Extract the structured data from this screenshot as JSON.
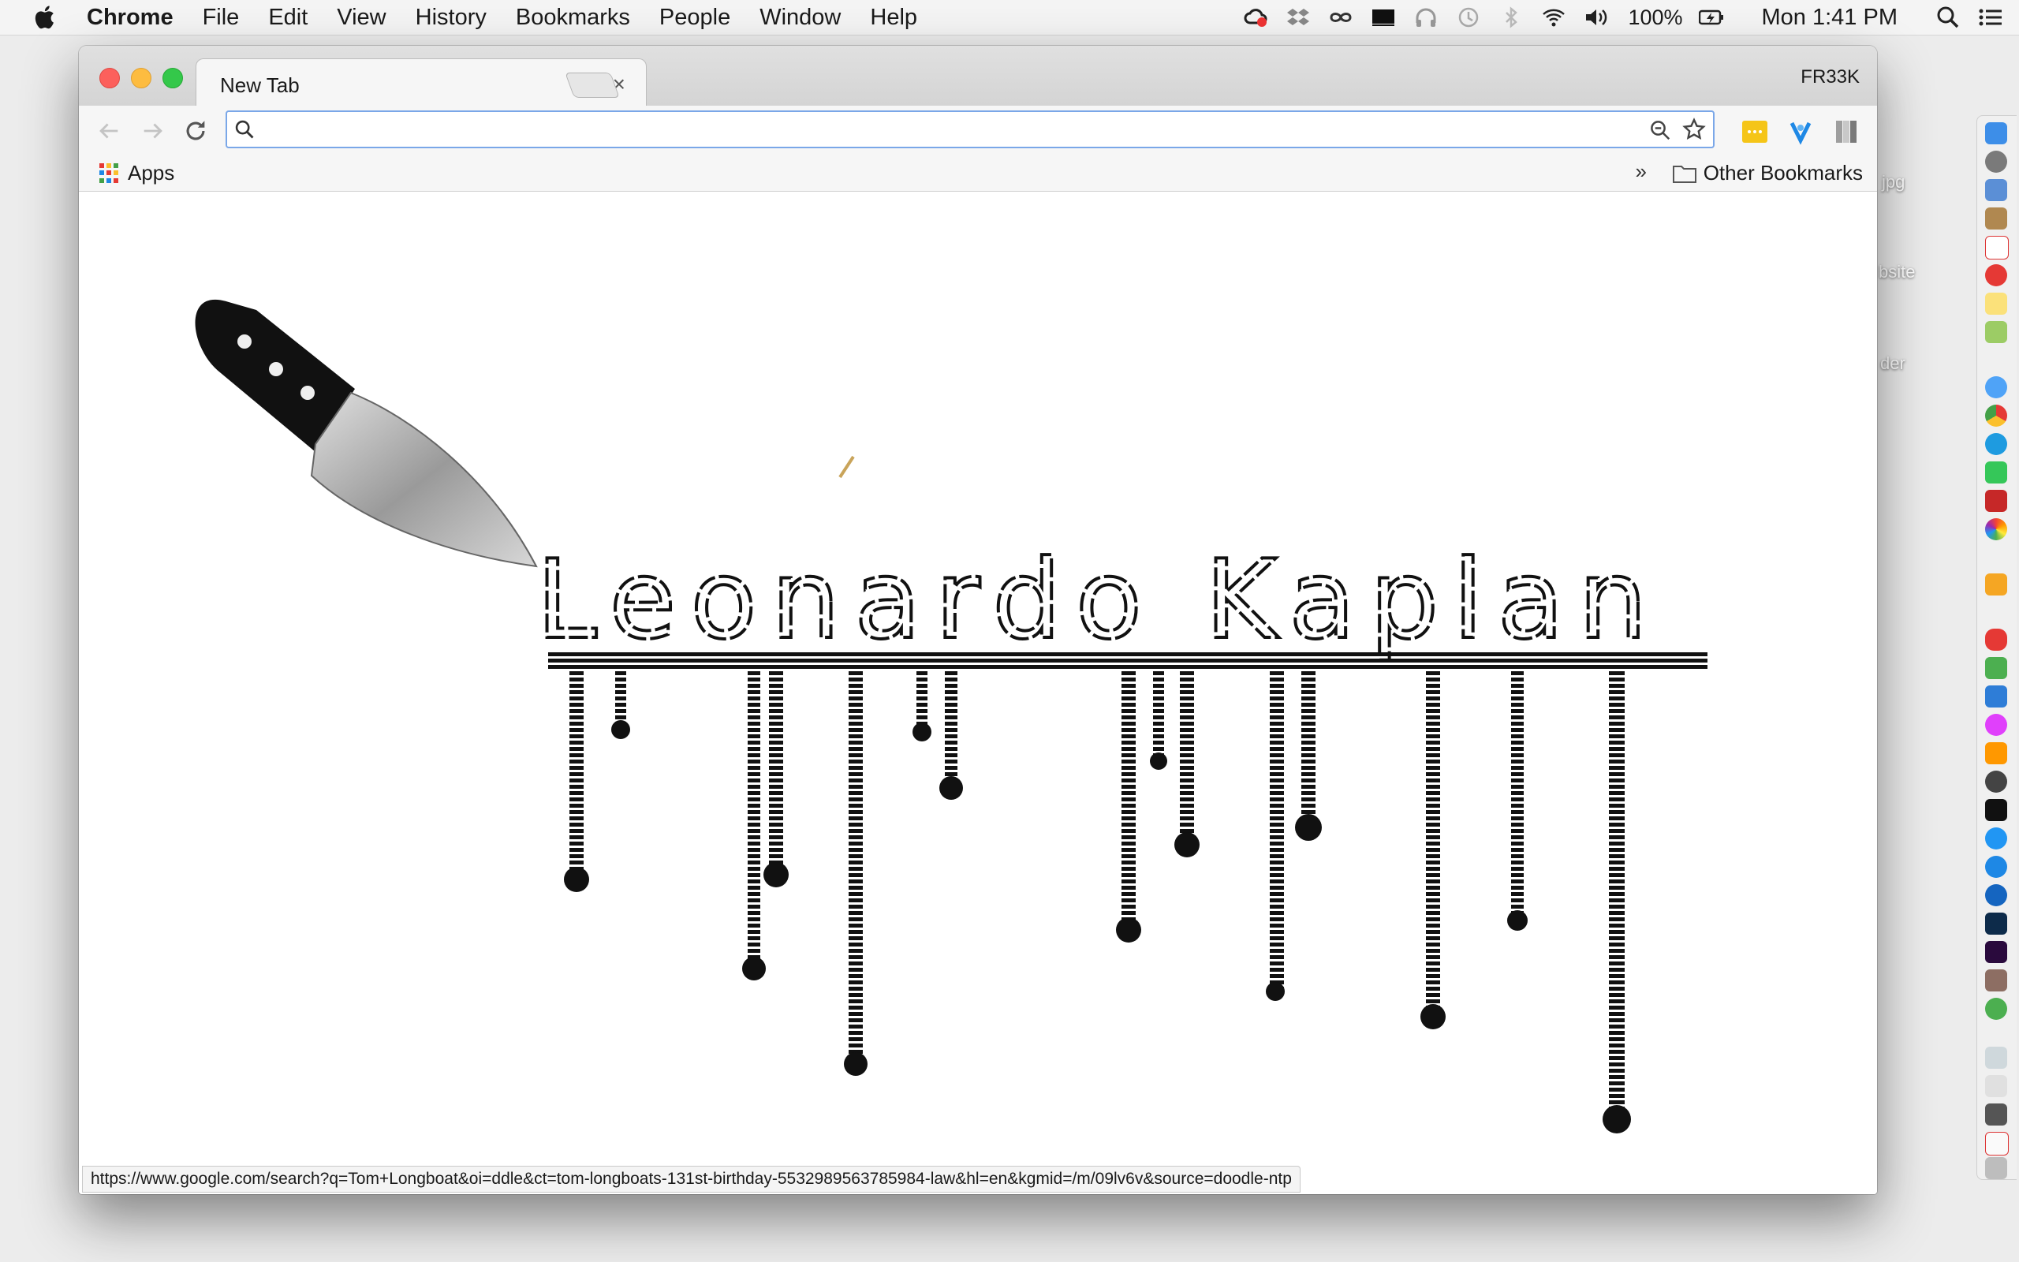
{
  "menubar": {
    "app_name": "Chrome",
    "menus": [
      "File",
      "Edit",
      "View",
      "History",
      "Bookmarks",
      "People",
      "Window",
      "Help"
    ],
    "battery_percent": "100%",
    "clock": "Mon 1:41 PM"
  },
  "desktop": {
    "labels": [
      "jpg",
      "bsite",
      "der"
    ]
  },
  "browser": {
    "tab_title": "New Tab",
    "tab_close": "×",
    "profile_name": "FR33K",
    "omnibox": {
      "value": "",
      "placeholder": ""
    },
    "bookmarks": {
      "apps_label": "Apps",
      "overflow_label": "»",
      "other_label": "Other Bookmarks"
    },
    "doodle": {
      "text": "Leonardo Kaplan"
    },
    "status_url": "https://www.google.com/search?q=Tom+Longboat&oi=ddle&ct=tom-longboats-131st-birthday-5532989563785984-law&hl=en&kgmid=/m/09lv6v&source=doodle-ntp"
  },
  "colors": {
    "omnibox_focus": "#7aa7e8",
    "traffic_close": "#fc605c",
    "traffic_min": "#fdbc40",
    "traffic_max": "#34c84a"
  },
  "icons": {
    "menubar_status": [
      "creative-cloud-icon",
      "dropbox-icon",
      "infinity-icon",
      "display-icon",
      "headphones-icon",
      "time-machine-icon",
      "bluetooth-icon",
      "wifi-icon",
      "volume-icon",
      "battery-icon"
    ],
    "menubar_right": [
      "spotlight-icon",
      "notification-center-icon"
    ],
    "extensions": [
      "notes-extension-icon",
      "vpn-extension-icon",
      "reader-extension-icon",
      "cursor-extension-icon",
      "chrome-menu-icon"
    ]
  }
}
